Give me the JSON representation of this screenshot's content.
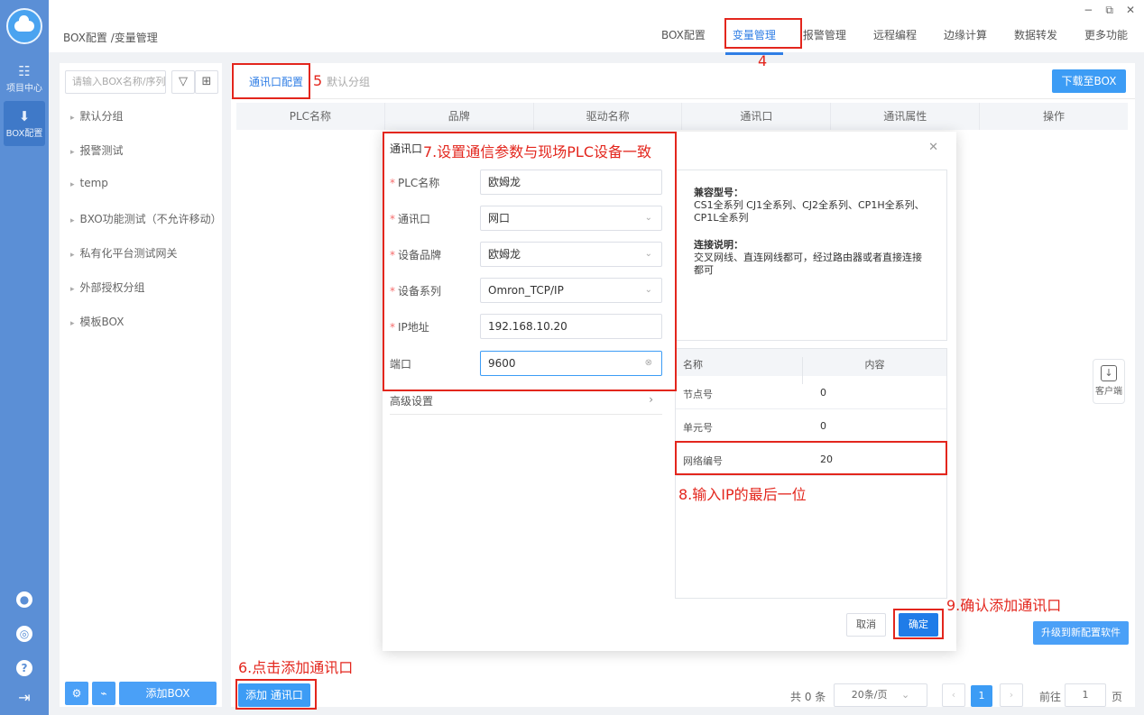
{
  "window": {
    "min": "−",
    "max": "⧉",
    "close": "✕"
  },
  "rail": {
    "items": [
      {
        "label": "项目中心",
        "icon": "grid-icon"
      },
      {
        "label": "BOX配置",
        "icon": "download-icon"
      }
    ]
  },
  "breadcrumb": "BOX配置 /变量管理",
  "nav": [
    "BOX配置",
    "变量管理",
    "报警管理",
    "远程编程",
    "边缘计算",
    "数据转发",
    "更多功能"
  ],
  "sidepanel": {
    "search_placeholder": "请输入BOX名称/序列号",
    "groups": [
      "默认分组",
      "报警测试",
      "temp",
      "BXO功能测试（不允许移动）",
      "私有化平台测试网关",
      "外部授权分组",
      "模板BOX"
    ],
    "add_box": "添加BOX"
  },
  "main": {
    "tabs": [
      "通讯口配置",
      "默认分组"
    ],
    "download": "下载至BOX",
    "columns": [
      "PLC名称",
      "品牌",
      "驱动名称",
      "通讯口",
      "通讯属性",
      "操作"
    ],
    "add_port": "添加 通讯口",
    "total": "共 0 条",
    "page_size": "20条/页",
    "current_page": "1",
    "goto_prefix": "前往",
    "goto_value": "1",
    "goto_suffix": "页"
  },
  "modal": {
    "title": "通讯口",
    "fields": [
      {
        "label": "PLC名称",
        "value": "欧姆龙",
        "required": true
      },
      {
        "label": "通讯口",
        "value": "网口",
        "required": true
      },
      {
        "label": "设备品牌",
        "value": "欧姆龙",
        "required": true
      },
      {
        "label": "设备系列",
        "value": "Omron_TCP/IP",
        "required": true
      },
      {
        "label": "IP地址",
        "value": "192.168.10.20",
        "required": true
      },
      {
        "label": "端口",
        "value": "9600",
        "required": false
      }
    ],
    "advanced": "高级设置",
    "compat_title": "兼容型号：",
    "compat_text": "CS1全系列 CJ1全系列、CJ2全系列、CP1H全系列、CP1L全系列",
    "conn_title": "连接说明：",
    "conn_text": "交叉网线、直连网线都可，经过路由器或者直接连接都可",
    "param_header": [
      "名称",
      "内容"
    ],
    "params": [
      {
        "name": "节点号",
        "value": "0"
      },
      {
        "name": "单元号",
        "value": "0"
      },
      {
        "name": "网络编号",
        "value": "20"
      }
    ],
    "cancel": "取消",
    "ok": "确定"
  },
  "upgrade": "升级到新配置软件",
  "client": "客户端",
  "annotations": {
    "a4": "4",
    "a5": "5",
    "a6": "6.点击添加通讯口",
    "a7": "7.设置通信参数与现场PLC设备一致",
    "a8": "8.输入IP的最后一位",
    "a9": "9.确认添加通讯口"
  }
}
